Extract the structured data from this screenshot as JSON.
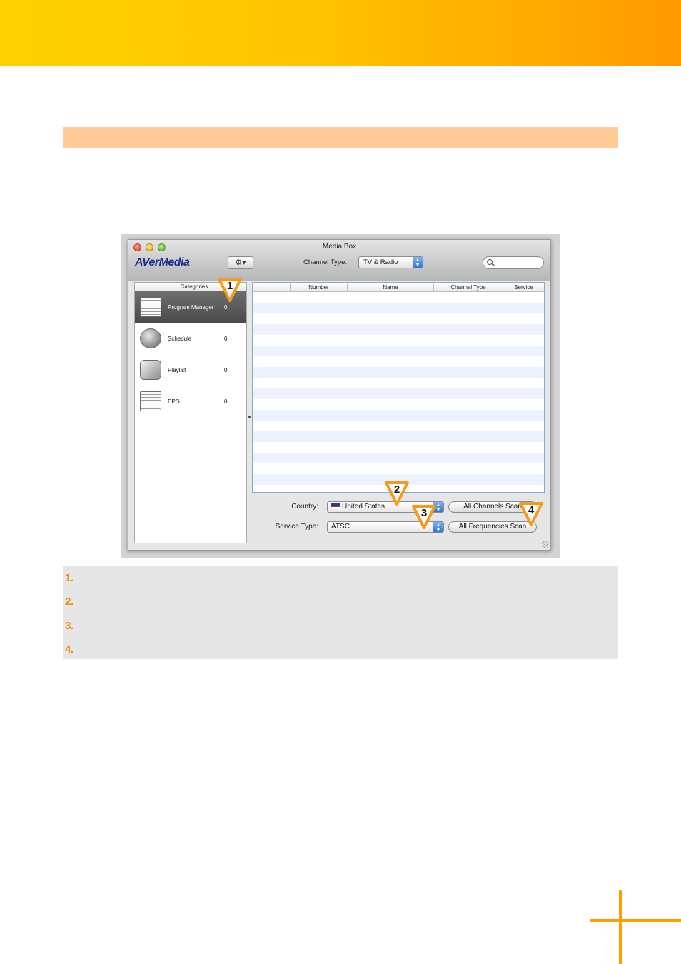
{
  "screenshot": {
    "window_title": "Media Box",
    "logo_text": "AVerMedia",
    "gear_label": "⚙▾",
    "channel_type_label": "Channel Type:",
    "channel_type_value": "TV & Radio",
    "sidebar": {
      "header": "Categories",
      "items": [
        {
          "label": "Program Manager",
          "count": "0",
          "icon": "program-manager-icon",
          "selected": true
        },
        {
          "label": "Schedule",
          "count": "0",
          "icon": "schedule-icon",
          "selected": false
        },
        {
          "label": "Playlist",
          "count": "0",
          "icon": "playlist-icon",
          "selected": false
        },
        {
          "label": "EPG",
          "count": "0",
          "icon": "epg-icon",
          "selected": false
        }
      ]
    },
    "table": {
      "columns": [
        "Number",
        "Name",
        "Channel Type",
        "Service"
      ]
    },
    "country_label": "Country:",
    "country_value": "United States",
    "service_type_label": "Service Type:",
    "service_type_value": "ATSC",
    "all_channels_scan_label": "All Channels Scan",
    "all_frequencies_scan_label": "All Frequencies Scan"
  },
  "callouts": [
    "1",
    "2",
    "3",
    "4"
  ],
  "legend": [
    "1.",
    "2.",
    "3.",
    "4."
  ],
  "colors": {
    "banner_start": "#ffd200",
    "banner_end": "#ff9a00",
    "section_bar": "#ffcc99",
    "legend_background": "#e6e6e6",
    "accent_orange": "#f28a00"
  }
}
